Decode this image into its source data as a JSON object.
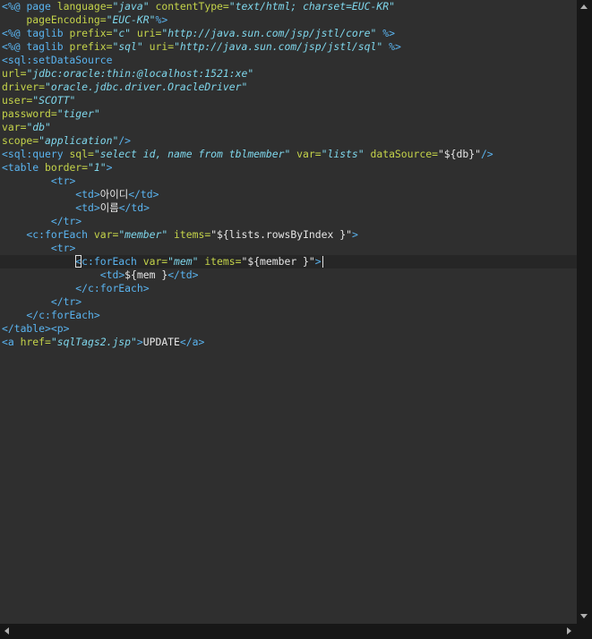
{
  "colors": {
    "background": "#2f2f2f",
    "current_line": "#262626",
    "tag": "#5ab4f0",
    "attribute": "#c5d44a",
    "value": "#7fd7ec",
    "text": "#e6e6e6",
    "scrollbar": "#171717"
  },
  "editor": {
    "current_line_index": 19,
    "lines": [
      [
        {
          "t": "<%@ ",
          "c": "tag"
        },
        {
          "t": "page ",
          "c": "tag"
        },
        {
          "t": "language=",
          "c": "attribute"
        },
        {
          "t": "\"java\"",
          "c": "value"
        },
        {
          "t": " contentType=",
          "c": "attribute"
        },
        {
          "t": "\"text/html; charset=EUC-KR\"",
          "c": "value"
        }
      ],
      [
        {
          "t": "    pageEncoding=",
          "c": "attribute"
        },
        {
          "t": "\"EUC-KR\"",
          "c": "value"
        },
        {
          "t": "%>",
          "c": "tag"
        }
      ],
      [
        {
          "t": "<%@ ",
          "c": "tag"
        },
        {
          "t": "taglib ",
          "c": "tag"
        },
        {
          "t": "prefix=",
          "c": "attribute"
        },
        {
          "t": "\"c\"",
          "c": "value"
        },
        {
          "t": " uri=",
          "c": "attribute"
        },
        {
          "t": "\"http://java.sun.com/jsp/jstl/core\"",
          "c": "value"
        },
        {
          "t": " %>",
          "c": "tag"
        }
      ],
      [
        {
          "t": "<%@ ",
          "c": "tag"
        },
        {
          "t": "taglib ",
          "c": "tag"
        },
        {
          "t": "prefix=",
          "c": "attribute"
        },
        {
          "t": "\"sql\"",
          "c": "value"
        },
        {
          "t": " uri=",
          "c": "attribute"
        },
        {
          "t": "\"http://java.sun.com/jsp/jstl/sql\"",
          "c": "value"
        },
        {
          "t": " %>",
          "c": "tag"
        }
      ],
      [
        {
          "t": "<",
          "c": "tag"
        },
        {
          "t": "sql:setDataSource",
          "c": "tag"
        }
      ],
      [
        {
          "t": "url=",
          "c": "attribute"
        },
        {
          "t": "\"jdbc:oracle:thin:@localhost:1521:xe\"",
          "c": "value"
        }
      ],
      [
        {
          "t": "driver=",
          "c": "attribute"
        },
        {
          "t": "\"oracle.jdbc.driver.OracleDriver\"",
          "c": "value"
        }
      ],
      [
        {
          "t": "user=",
          "c": "attribute"
        },
        {
          "t": "\"SCOTT\"",
          "c": "value"
        }
      ],
      [
        {
          "t": "password=",
          "c": "attribute"
        },
        {
          "t": "\"tiger\"",
          "c": "value"
        }
      ],
      [
        {
          "t": "var=",
          "c": "attribute"
        },
        {
          "t": "\"db\"",
          "c": "value"
        }
      ],
      [
        {
          "t": "scope=",
          "c": "attribute"
        },
        {
          "t": "\"application\"",
          "c": "value"
        },
        {
          "t": "/>",
          "c": "tag"
        }
      ],
      [
        {
          "t": "<",
          "c": "tag"
        },
        {
          "t": "sql:query ",
          "c": "tag"
        },
        {
          "t": "sql=",
          "c": "attribute"
        },
        {
          "t": "\"select id, name from tblmember\"",
          "c": "value"
        },
        {
          "t": " var=",
          "c": "attribute"
        },
        {
          "t": "\"lists\"",
          "c": "value"
        },
        {
          "t": " dataSource=",
          "c": "attribute"
        },
        {
          "t": "\"${db}\"",
          "c": "text"
        },
        {
          "t": "/>",
          "c": "tag"
        }
      ],
      [
        {
          "t": "<",
          "c": "tag"
        },
        {
          "t": "table ",
          "c": "tag"
        },
        {
          "t": "border=",
          "c": "attribute"
        },
        {
          "t": "\"1\"",
          "c": "value"
        },
        {
          "t": ">",
          "c": "tag"
        }
      ],
      [
        {
          "t": "        <",
          "c": "tag"
        },
        {
          "t": "tr",
          "c": "tag"
        },
        {
          "t": ">",
          "c": "tag"
        }
      ],
      [
        {
          "t": "            <",
          "c": "tag"
        },
        {
          "t": "td",
          "c": "tag"
        },
        {
          "t": ">",
          "c": "tag"
        },
        {
          "t": "아이디",
          "c": "text"
        },
        {
          "t": "</",
          "c": "tag"
        },
        {
          "t": "td",
          "c": "tag"
        },
        {
          "t": ">",
          "c": "tag"
        }
      ],
      [
        {
          "t": "            <",
          "c": "tag"
        },
        {
          "t": "td",
          "c": "tag"
        },
        {
          "t": ">",
          "c": "tag"
        },
        {
          "t": "이름",
          "c": "text"
        },
        {
          "t": "</",
          "c": "tag"
        },
        {
          "t": "td",
          "c": "tag"
        },
        {
          "t": ">",
          "c": "tag"
        }
      ],
      [
        {
          "t": "        </",
          "c": "tag"
        },
        {
          "t": "tr",
          "c": "tag"
        },
        {
          "t": ">",
          "c": "tag"
        }
      ],
      [
        {
          "t": "    <",
          "c": "tag"
        },
        {
          "t": "c:forEach ",
          "c": "tag"
        },
        {
          "t": "var=",
          "c": "attribute"
        },
        {
          "t": "\"member\"",
          "c": "value"
        },
        {
          "t": " items=",
          "c": "attribute"
        },
        {
          "t": "\"${lists.rowsByIndex }\"",
          "c": "text"
        },
        {
          "t": ">",
          "c": "tag"
        }
      ],
      [
        {
          "t": "        <",
          "c": "tag"
        },
        {
          "t": "tr",
          "c": "tag"
        },
        {
          "t": ">",
          "c": "tag"
        }
      ],
      [
        {
          "t": "            ",
          "c": "text"
        },
        {
          "t": "<",
          "c": "tag",
          "box": true
        },
        {
          "t": "c:forEach ",
          "c": "tag"
        },
        {
          "t": "var=",
          "c": "attribute"
        },
        {
          "t": "\"mem\"",
          "c": "value"
        },
        {
          "t": " items=",
          "c": "attribute"
        },
        {
          "t": "\"${member }\"",
          "c": "text"
        },
        {
          "t": ">",
          "c": "tag"
        }
      ],
      [
        {
          "t": "                <",
          "c": "tag"
        },
        {
          "t": "td",
          "c": "tag"
        },
        {
          "t": ">",
          "c": "tag"
        },
        {
          "t": "${mem }",
          "c": "text"
        },
        {
          "t": "</",
          "c": "tag"
        },
        {
          "t": "td",
          "c": "tag"
        },
        {
          "t": ">",
          "c": "tag"
        }
      ],
      [
        {
          "t": "            </",
          "c": "tag"
        },
        {
          "t": "c:forEach",
          "c": "tag"
        },
        {
          "t": ">",
          "c": "tag"
        }
      ],
      [
        {
          "t": "        </",
          "c": "tag"
        },
        {
          "t": "tr",
          "c": "tag"
        },
        {
          "t": ">",
          "c": "tag"
        }
      ],
      [
        {
          "t": "    </",
          "c": "tag"
        },
        {
          "t": "c:forEach",
          "c": "tag"
        },
        {
          "t": ">",
          "c": "tag"
        }
      ],
      [
        {
          "t": "</",
          "c": "tag"
        },
        {
          "t": "table",
          "c": "tag"
        },
        {
          "t": "><",
          "c": "tag"
        },
        {
          "t": "p",
          "c": "tag"
        },
        {
          "t": ">",
          "c": "tag"
        }
      ],
      [
        {
          "t": "<",
          "c": "tag"
        },
        {
          "t": "a ",
          "c": "tag"
        },
        {
          "t": "href=",
          "c": "attribute"
        },
        {
          "t": "\"sqlTags2.jsp\"",
          "c": "value"
        },
        {
          "t": ">",
          "c": "tag"
        },
        {
          "t": "UPDATE",
          "c": "text"
        },
        {
          "t": "</",
          "c": "tag"
        },
        {
          "t": "a",
          "c": "tag"
        },
        {
          "t": ">",
          "c": "tag"
        }
      ]
    ]
  },
  "scrollbars": {
    "vertical": {
      "up_icon": "arrow-up-icon",
      "down_icon": "arrow-down-icon"
    },
    "horizontal": {
      "left_icon": "arrow-left-icon",
      "right_icon": "arrow-right-icon"
    }
  }
}
